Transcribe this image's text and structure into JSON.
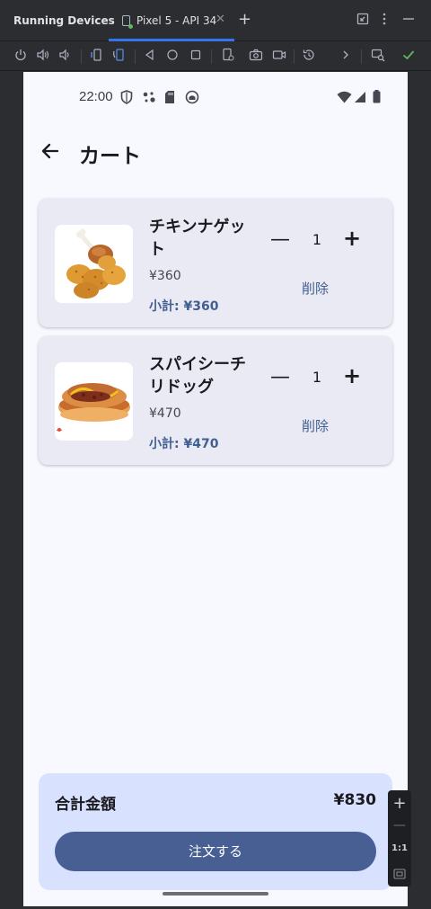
{
  "ide": {
    "panel_title": "Running Devices",
    "device_tab": "Pixel 5 - API 34"
  },
  "status_bar": {
    "time": "22:00"
  },
  "app_bar": {
    "title": "カート"
  },
  "cart": {
    "items": [
      {
        "name": "チキンナゲット",
        "price": "¥360",
        "quantity": "1",
        "subtotal": "小計: ¥360",
        "delete_label": "削除",
        "image_icon": "chicken-nugget-image"
      },
      {
        "name": "スパイシーチリドッグ",
        "price": "¥470",
        "quantity": "1",
        "subtotal": "小計: ¥470",
        "delete_label": "削除",
        "image_icon": "chili-dog-image"
      }
    ]
  },
  "summary": {
    "total_label": "合計金額",
    "total_value": "¥830",
    "order_button": "注文する"
  },
  "zoom_panel": {
    "ratio_label": "1:1"
  },
  "colors": {
    "accent": "#485f93",
    "subtotal": "#415f91",
    "card_bg": "#e9eaf4",
    "summary_bg": "#d8e2ff",
    "ide_tab_underline": "#3574f0"
  }
}
